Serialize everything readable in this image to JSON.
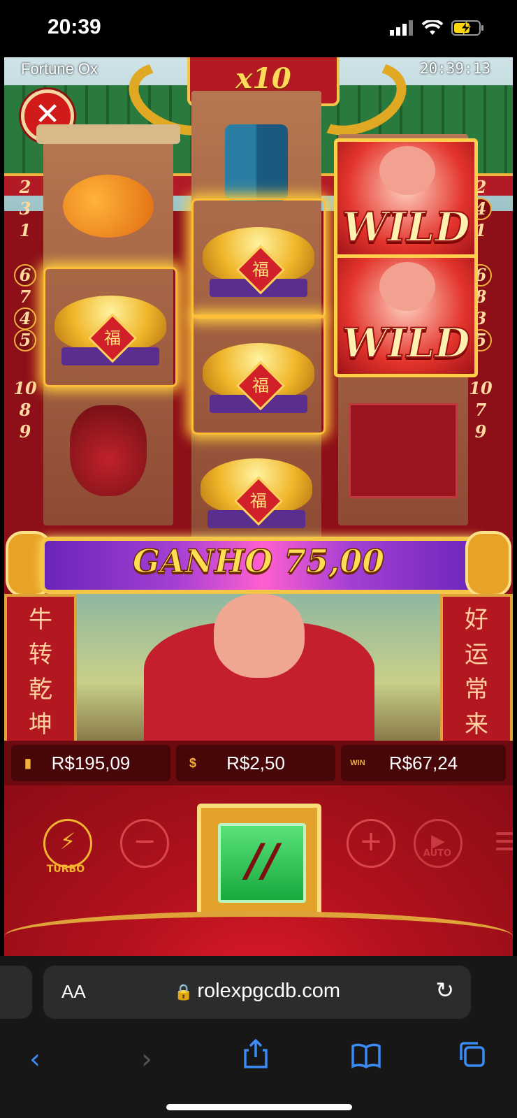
{
  "status_bar": {
    "time": "20:39"
  },
  "game": {
    "title": "Fortune Ox",
    "clock": "20:39:13",
    "multiplier": "x10",
    "close_icon": "close-icon",
    "paylines_left": {
      "top": [
        "2",
        "3",
        "1"
      ],
      "middle": [
        "6",
        "7",
        "4",
        "5"
      ],
      "bottom": [
        "10",
        "8",
        "9"
      ]
    },
    "paylines_right": {
      "top": [
        "2",
        "4",
        "1"
      ],
      "middle": [
        "6",
        "8",
        "3",
        "5"
      ],
      "bottom": [
        "10",
        "7",
        "9"
      ]
    },
    "wild_label": "WILD",
    "fu_char": "福",
    "win_banner": "GANHO 75,00",
    "pillar_left": [
      "牛",
      "转",
      "乾",
      "坤"
    ],
    "pillar_right": [
      "好",
      "运",
      "常",
      "来"
    ],
    "balance": "R$195,09",
    "bet": "R$2,50",
    "win": "R$67,24",
    "win_icon": "WIN",
    "turbo_label": "TURBO",
    "auto_label": "AUTO",
    "spin_glyph": "//"
  },
  "browser": {
    "aa_label": "AA",
    "url": "rolexpgcdb.com"
  }
}
